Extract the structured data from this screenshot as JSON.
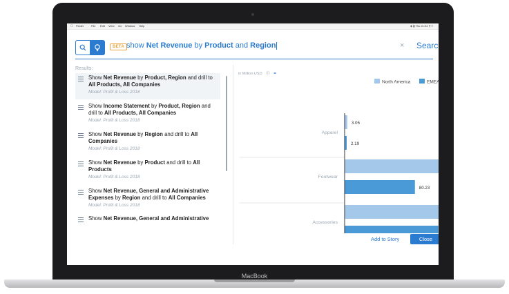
{
  "device": {
    "brand": "MacBook"
  },
  "menubar": {
    "app": "Finder",
    "items": [
      "File",
      "Edit",
      "View",
      "Go",
      "Window",
      "Help"
    ],
    "time": "Thu 21:04"
  },
  "search": {
    "beta": "BETA",
    "query_parts": [
      "show ",
      "Net Revenue",
      " by ",
      "Product",
      " and ",
      "Region"
    ],
    "clear_glyph": "×",
    "search_label": "Search"
  },
  "results_label": "Results:",
  "results": [
    {
      "html": "Show <b>Net Revenue</b> by <b>Product, Region</b> and drill to <b>All Products, All Companies</b>",
      "model": "Model: Profit & Loss 2018"
    },
    {
      "html": "Show <b>Income Statement</b> by <b>Product, Region</b> and drill to <b>All Products, All Companies</b>",
      "model": "Model: Profit & Loss 2018"
    },
    {
      "html": "Show <b>Net Revenue</b> by <b>Region</b> and drill to <b>All Companies</b>",
      "model": "Model: Profit & Loss 2018"
    },
    {
      "html": "Show <b>Net Revenue</b> by <b>Product</b> and drill to <b>All Products</b>",
      "model": "Model: Profit & Loss 2018"
    },
    {
      "html": "Show <b>Net Revenue, General and Administrative Expenses</b> by <b>Region</b> and drill to <b>All Companies</b>",
      "model": "Model: Profit & Loss 2018"
    },
    {
      "html": "Show <b>Net Revenue, General and Administrative</b>",
      "model": ""
    }
  ],
  "chart_unit": "in Million USD",
  "chart_data": {
    "type": "bar",
    "orientation": "horizontal",
    "categories": [
      "Apparel",
      "Footwear",
      "Accessories"
    ],
    "series": [
      {
        "name": "North America",
        "values": [
          3.05,
          109.27,
          157.05
        ]
      },
      {
        "name": "EMEA",
        "values": [
          2.19,
          80.23,
          106.92
        ]
      }
    ],
    "legend_position": "top",
    "colors": {
      "North America": "#a3c8ea",
      "EMEA": "#4a9ad8"
    }
  },
  "footer": {
    "add_label": "Add to Story",
    "close_label": "Close"
  }
}
